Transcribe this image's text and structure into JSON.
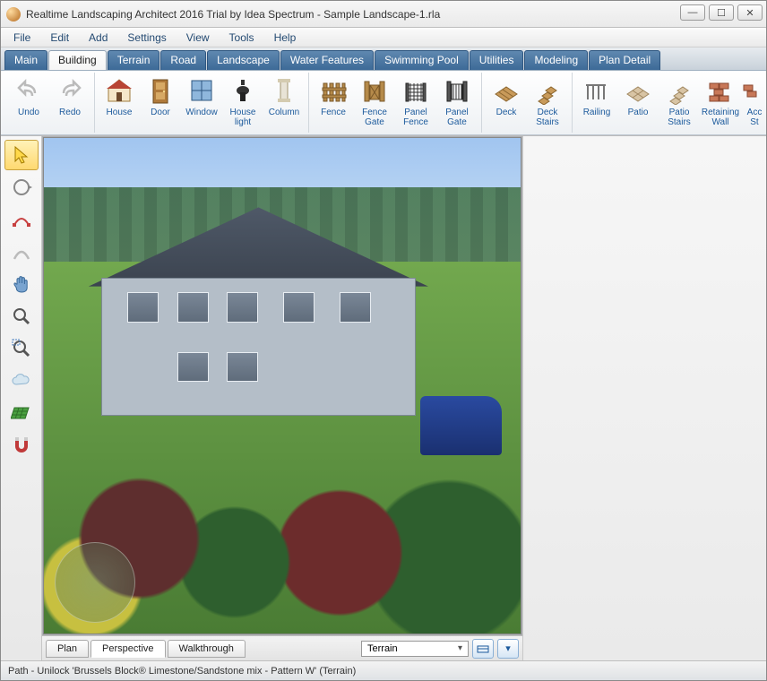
{
  "title": "Realtime Landscaping Architect 2016 Trial by Idea Spectrum - Sample Landscape-1.rla",
  "menu": [
    "File",
    "Edit",
    "Add",
    "Settings",
    "View",
    "Tools",
    "Help"
  ],
  "ribbon_tabs": [
    "Main",
    "Building",
    "Terrain",
    "Road",
    "Landscape",
    "Water Features",
    "Swimming Pool",
    "Utilities",
    "Modeling",
    "Plan Detail"
  ],
  "ribbon_active": "Building",
  "ribbon": {
    "undo": "Undo",
    "redo": "Redo",
    "house": "House",
    "door": "Door",
    "window": "Window",
    "house_light": "House\nlight",
    "column": "Column",
    "fence": "Fence",
    "fence_gate": "Fence\nGate",
    "panel_fence": "Panel\nFence",
    "panel_gate": "Panel\nGate",
    "deck": "Deck",
    "deck_stairs": "Deck\nStairs",
    "railing": "Railing",
    "patio": "Patio",
    "patio_stairs": "Patio\nStairs",
    "retaining_wall": "Retaining\nWall",
    "accent": "Acc\nSt"
  },
  "side_tools": [
    {
      "name": "select",
      "icon": "cursor",
      "active": true
    },
    {
      "name": "orbit",
      "icon": "orbit"
    },
    {
      "name": "edit-points",
      "icon": "points"
    },
    {
      "name": "curve",
      "icon": "curve"
    },
    {
      "name": "pan",
      "icon": "hand"
    },
    {
      "name": "zoom",
      "icon": "zoom"
    },
    {
      "name": "zoom-extents",
      "icon": "zoom-ext"
    },
    {
      "name": "cloud",
      "icon": "cloud"
    },
    {
      "name": "grid",
      "icon": "grid"
    },
    {
      "name": "snap",
      "icon": "magnet"
    }
  ],
  "view_tabs": [
    "Plan",
    "Perspective",
    "Walkthrough"
  ],
  "view_active": "Perspective",
  "layer_select": "Terrain",
  "status": "Path - Unilock 'Brussels Block® Limestone/Sandstone mix - Pattern W' (Terrain)"
}
